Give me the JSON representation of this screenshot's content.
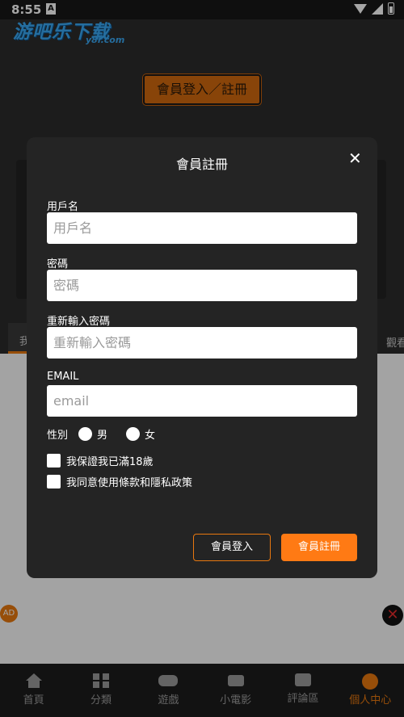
{
  "status_bar": {
    "time": "8:55",
    "notification_glyph": "A"
  },
  "watermark": {
    "main": "游吧乐下载",
    "sub": "y8l.com"
  },
  "background": {
    "login_register_button": "會員登入／註冊",
    "tab_left": "我",
    "tab_right": "觀看",
    "ad_badge": "AD",
    "ad_close": "✕"
  },
  "bottom_nav": [
    {
      "label": "首頁",
      "icon": "home-icon"
    },
    {
      "label": "分類",
      "icon": "grid-icon"
    },
    {
      "label": "遊戲",
      "icon": "gamepad-icon"
    },
    {
      "label": "小電影",
      "icon": "video-icon"
    },
    {
      "label": "評論區",
      "icon": "chat-icon"
    },
    {
      "label": "個人中心",
      "icon": "user-icon",
      "active": true
    }
  ],
  "modal": {
    "title": "會員註冊",
    "close": "✕",
    "username": {
      "label": "用戶名",
      "placeholder": "用戶名"
    },
    "password": {
      "label": "密碼",
      "placeholder": "密碼"
    },
    "password_confirm": {
      "label": "重新輸入密碼",
      "placeholder": "重新輸入密碼"
    },
    "email": {
      "label": "EMAIL",
      "placeholder": "email"
    },
    "gender": {
      "label": "性別",
      "male": "男",
      "female": "女"
    },
    "age_check": "我保證我已滿18歲",
    "terms_check": "我同意使用條款和隱私政策",
    "login_button": "會員登入",
    "register_button": "會員註冊"
  },
  "colors": {
    "accent": "#ff7a14",
    "modal_bg": "#242424",
    "nav_bg": "#1d1d1d"
  }
}
